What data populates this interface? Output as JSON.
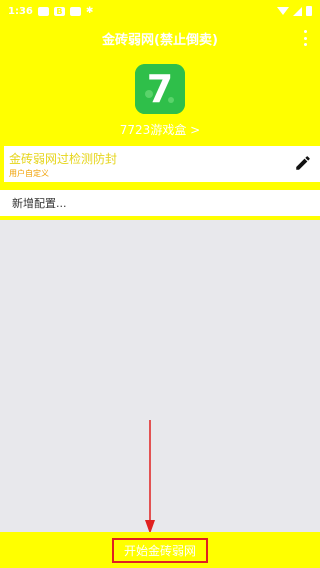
{
  "status_bar": {
    "time": "1:36",
    "b_badge": "B"
  },
  "app_bar": {
    "title": "金砖弱网(禁止倒卖)"
  },
  "app": {
    "logo_text": "7",
    "link_label": "7723游戏盒 >"
  },
  "config": {
    "title": "金砖弱网过检测防封",
    "subtitle": "用户自定义"
  },
  "new_config": {
    "label": "新增配置..."
  },
  "bottom": {
    "start_button": "开始金砖弱网"
  },
  "colors": {
    "brand": "#ffff00",
    "logo_green": "#2fbf4a",
    "annotation_red": "#e02020"
  },
  "icons": [
    "wifi-icon",
    "signal-icon",
    "battery-icon",
    "overflow-menu-icon",
    "edit-pencil-icon"
  ]
}
